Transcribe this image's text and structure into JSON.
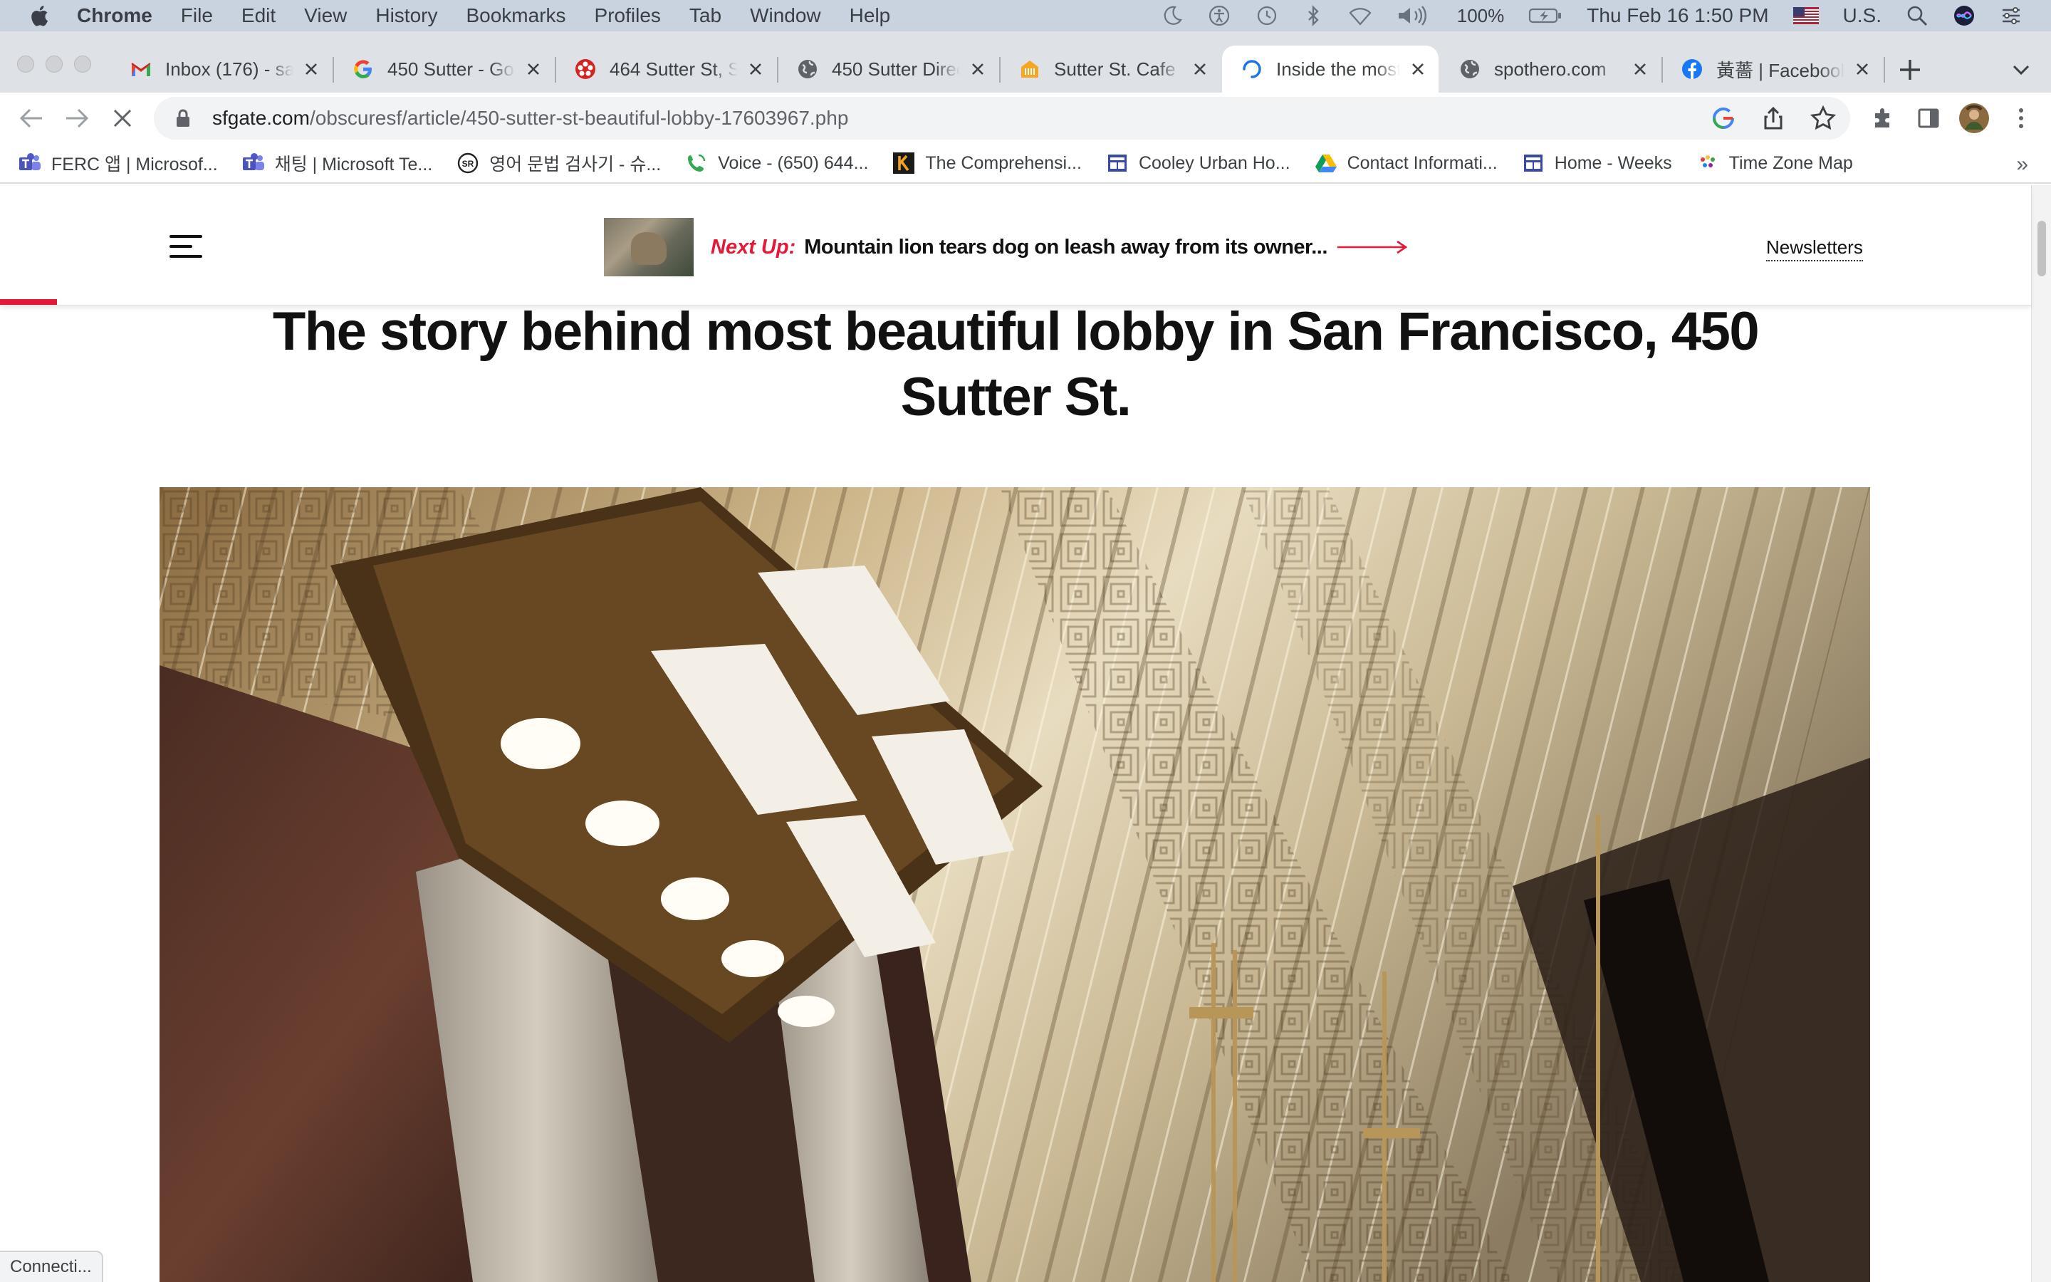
{
  "menubar": {
    "app": "Chrome",
    "items": [
      "File",
      "Edit",
      "View",
      "History",
      "Bookmarks",
      "Profiles",
      "Tab",
      "Window",
      "Help"
    ],
    "battery": "100%",
    "datetime": "Thu Feb 16  1:50 PM",
    "input_source": "U.S."
  },
  "tabs": [
    {
      "title": "Inbox (176) - sa",
      "icon": "gmail-icon"
    },
    {
      "title": "450 Sutter - Go",
      "icon": "google-icon"
    },
    {
      "title": "464 Sutter St, S",
      "icon": "yelp-icon"
    },
    {
      "title": "450 Sutter Direc",
      "icon": "globe-icon"
    },
    {
      "title": "Sutter St. Cafe I",
      "icon": "restaurant-icon"
    },
    {
      "title": "Inside the most",
      "icon": "loading-icon",
      "active": true
    },
    {
      "title": "spothero.com",
      "icon": "globe-icon"
    },
    {
      "title": "黃薔 | Facebook",
      "icon": "facebook-icon"
    }
  ],
  "address_bar": {
    "host": "sfgate.com",
    "path": "/obscuresf/article/450-sutter-st-beautiful-lobby-17603967.php"
  },
  "bookmarks": [
    {
      "label": "FERC 앱 | Microsof...",
      "icon": "teams-icon"
    },
    {
      "label": "채팅 | Microsoft Te...",
      "icon": "teams-icon"
    },
    {
      "label": "영어 문법 검사기 - 슈...",
      "icon": "sr-icon"
    },
    {
      "label": "Voice - (650) 644...",
      "icon": "voice-icon"
    },
    {
      "label": "The Comprehensi...",
      "icon": "k-icon"
    },
    {
      "label": "Cooley Urban Ho...",
      "icon": "form-icon"
    },
    {
      "label": "Contact Informati...",
      "icon": "drive-icon"
    },
    {
      "label": "Home - Weeks",
      "icon": "form-icon"
    },
    {
      "label": "Time Zone Map",
      "icon": "timezone-icon"
    }
  ],
  "bookmarks_more": "»",
  "site": {
    "next_up_label": "Next Up:",
    "next_up_headline": "Mountain lion tears dog on leash away from its owner...",
    "newsletters": "Newsletters"
  },
  "article": {
    "title": "The story behind most beautiful lobby in San Francisco, 450 Sutter St."
  },
  "status": "Connecti..."
}
